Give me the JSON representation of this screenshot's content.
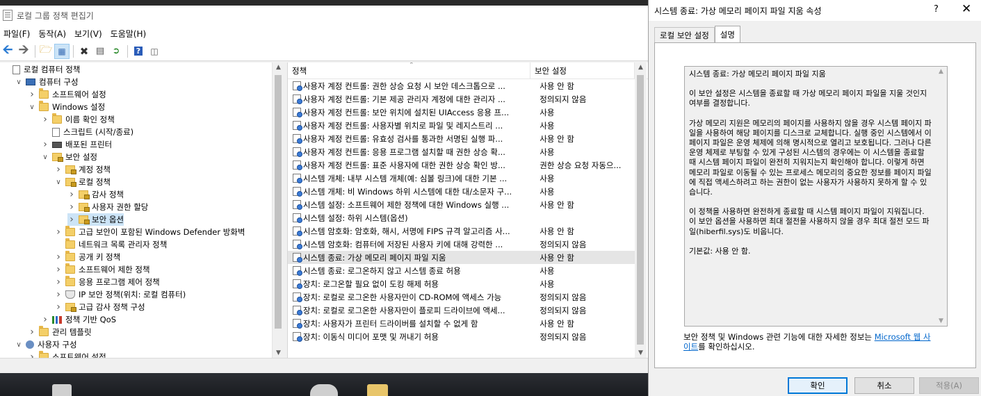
{
  "main_window": {
    "title": "로컬 그룹 정책 편집기",
    "menu": [
      "파일(F)",
      "동작(A)",
      "보기(V)",
      "도움말(H)"
    ]
  },
  "tree": {
    "items": [
      {
        "label": "로컬 컴퓨터 정책",
        "level": 0,
        "icon": "doc-icon",
        "expander": ""
      },
      {
        "label": "컴퓨터 구성",
        "level": 1,
        "icon": "computer-icon",
        "expander": "open"
      },
      {
        "label": "소프트웨어 설정",
        "level": 2,
        "icon": "folder-icon",
        "expander": "closed"
      },
      {
        "label": "Windows 설정",
        "level": 2,
        "icon": "folder-icon",
        "expander": "open"
      },
      {
        "label": "이름 확인 정책",
        "level": 3,
        "icon": "folder-icon",
        "expander": "closed"
      },
      {
        "label": "스크립트 (시작/종료)",
        "level": 3,
        "icon": "doc-icon",
        "expander": ""
      },
      {
        "label": "배포된 프린터",
        "level": 3,
        "icon": "printer-icon",
        "expander": "closed"
      },
      {
        "label": "보안 설정",
        "level": 3,
        "icon": "lock-folder-icon",
        "expander": "open"
      },
      {
        "label": "계정 정책",
        "level": 4,
        "icon": "lock-folder-icon",
        "expander": "closed"
      },
      {
        "label": "로컬 정책",
        "level": 4,
        "icon": "lock-folder-icon",
        "expander": "open"
      },
      {
        "label": "감사 정책",
        "level": 5,
        "icon": "lock-folder-icon",
        "expander": "closed"
      },
      {
        "label": "사용자 권한 할당",
        "level": 5,
        "icon": "lock-folder-icon",
        "expander": "closed"
      },
      {
        "label": "보안 옵션",
        "level": 5,
        "icon": "lock-folder-icon",
        "expander": "closed",
        "selected": true
      },
      {
        "label": "고급 보안이 포함된 Windows Defender 방화벽",
        "level": 4,
        "icon": "folder-icon",
        "expander": "closed"
      },
      {
        "label": "네트워크 목록 관리자 정책",
        "level": 4,
        "icon": "folder-icon",
        "expander": ""
      },
      {
        "label": "공개 키 정책",
        "level": 4,
        "icon": "folder-icon",
        "expander": "closed"
      },
      {
        "label": "소프트웨어 제한 정책",
        "level": 4,
        "icon": "folder-icon",
        "expander": "closed"
      },
      {
        "label": "응용 프로그램 제어 정책",
        "level": 4,
        "icon": "folder-icon",
        "expander": "closed"
      },
      {
        "label": "IP 보안 정책(위치: 로컬 컴퓨터)",
        "level": 4,
        "icon": "shield-icon",
        "expander": "closed"
      },
      {
        "label": "고급 감사 정책 구성",
        "level": 4,
        "icon": "lock-folder-icon",
        "expander": "closed"
      },
      {
        "label": "정책 기반 QoS",
        "level": 3,
        "icon": "chart-icon",
        "expander": "closed"
      },
      {
        "label": "관리 템플릿",
        "level": 2,
        "icon": "folder-icon",
        "expander": "closed"
      },
      {
        "label": "사용자 구성",
        "level": 1,
        "icon": "user-icon",
        "expander": "open"
      },
      {
        "label": "소프트웨어 설정",
        "level": 2,
        "icon": "folder-icon",
        "expander": "closed"
      }
    ]
  },
  "list": {
    "col_policy": "정책",
    "col_setting": "보안 설정",
    "rows": [
      {
        "name": "사용자 계정 컨트롤: 권한 상승 요청 시 보안 데스크톱으로 ...",
        "value": "사용 안 함"
      },
      {
        "name": "사용자 계정 컨트롤: 기본 제공 관리자 계정에 대한 관리자 ...",
        "value": "정의되지 않음"
      },
      {
        "name": "사용자 계정 컨트롤: 보안 위치에 설치된 UIAccess 응용 프...",
        "value": "사용"
      },
      {
        "name": "사용자 계정 컨트롤: 사용자별 위치로 파일 및 레지스트리 ...",
        "value": "사용"
      },
      {
        "name": "사용자 계정 컨트롤: 유효성 검사를 통과한 서명된 실행 파...",
        "value": "사용 안 함"
      },
      {
        "name": "사용자 계정 컨트롤: 응용 프로그램 설치할 때 권한 상승 확...",
        "value": "사용"
      },
      {
        "name": "사용자 계정 컨트롤: 표준 사용자에 대한 권한 상승 확인 방...",
        "value": "권한 상승 요청 자동으..."
      },
      {
        "name": "시스템 개체: 내부 시스템 개체(예: 심볼 링크)에 대한 기본 ...",
        "value": "사용"
      },
      {
        "name": "시스템 개체: 비 Windows 하위 시스템에 대한 대/소문자 구...",
        "value": "사용"
      },
      {
        "name": "시스템 설정: 소프트웨어 제한 정책에 대한 Windows 실행 ...",
        "value": "사용 안 함"
      },
      {
        "name": "시스템 설정: 하위 시스템(옵션)",
        "value": ""
      },
      {
        "name": "시스템 암호화: 암호화, 해시, 서명에 FIPS 규격 알고리즘 사...",
        "value": "사용 안 함"
      },
      {
        "name": "시스템 암호화: 컴퓨터에 저장된 사용자 키에 대해 강력한 ...",
        "value": "정의되지 않음"
      },
      {
        "name": "시스템 종료: 가상 메모리 페이지 파일 지움",
        "value": "사용 안 함",
        "selected": true
      },
      {
        "name": "시스템 종료: 로그온하지 않고 시스템 종료 허용",
        "value": "사용"
      },
      {
        "name": "장치: 로그온할 필요 없이 도킹 해제 허용",
        "value": "사용"
      },
      {
        "name": "장치: 로컬로 로그온한 사용자만이 CD-ROM에 액세스 가능",
        "value": "정의되지 않음"
      },
      {
        "name": "장치: 로컬로 로그온한 사용자만이 플로피 드라이브에 액세...",
        "value": "정의되지 않음"
      },
      {
        "name": "장치: 사용자가 프린터 드라이버를 설치할 수 없게 함",
        "value": "사용 안 함"
      },
      {
        "name": "장치: 이동식 미디어 포맷 및 꺼내기 허용",
        "value": "정의되지 않음"
      }
    ]
  },
  "dialog": {
    "title": "시스템 종료: 가상 메모리 페이지 파일 지움 속성",
    "help": "?",
    "tabs": [
      "로컬 보안 설정",
      "설명"
    ],
    "explain_paragraphs": [
      "시스템 종료: 가상 메모리 페이지 파일 지움",
      "이 보안 설정은 시스템을 종료할 때 가상 메모리 페이지 파일을 지울 것인지 여부를 결정합니다.",
      "가상 메모리 지원은 메모리의 페이지를 사용하지 않을 경우 시스템 페이지 파일을 사용하여 해당 페이지를 디스크로 교체합니다. 실행 중인 시스템에서 이 페이지 파일은 운영 체제에 의해 명시적으로 열리고 보호됩니다. 그러나 다른 운영 체제로 부팅할 수 있게 구성된 시스템의 경우에는 이 시스템을 종료할 때 시스템 페이지 파일이 완전히 지워지는지 확인해야 합니다. 이렇게 하면 메모리 파일로 이동될 수 있는 프로세스 메모리의 중요한 정보를 페이지 파일에 직접 액세스하려고 하는 권한이 없는 사용자가 사용하지 못하게 할 수 있습니다.",
      "이 정책을 사용하면 완전하게 종료할 때 시스템 페이지 파일이 지워집니다. 이 보안 옵션을 사용하면 최대 절전을 사용하지 않을 경우 최대 절전 모드 파일(hiberfil.sys)도 비웁니다.",
      "기본값: 사용 안 함."
    ],
    "moreinfo_prefix": "보안 정책 및 Windows 관련 기능에 대한 자세한 정보는 ",
    "moreinfo_link": "Microsoft 웹 사이트",
    "moreinfo_suffix": "를 확인하십시오.",
    "ok": "확인",
    "cancel": "취소",
    "apply": "적용(A)"
  }
}
